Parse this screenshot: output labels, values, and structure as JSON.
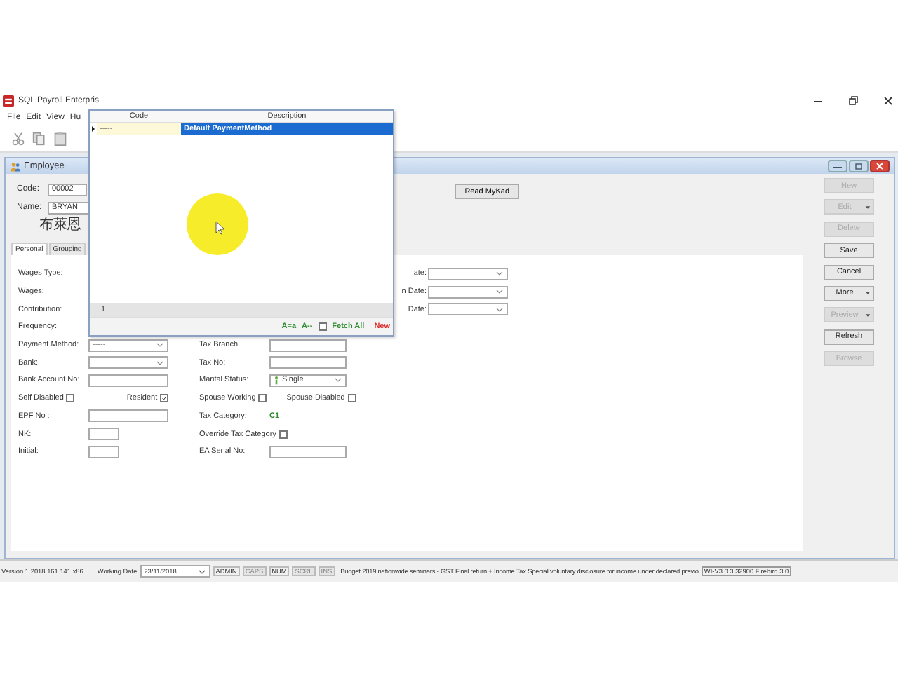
{
  "app": {
    "title": "SQL Payroll Enterpris",
    "menu": [
      "File",
      "Edit",
      "View",
      "Hu"
    ]
  },
  "employee_window": {
    "title": "Employee",
    "header": {
      "code_label": "Code:",
      "code": "00002",
      "name_label": "Name:",
      "name": "BRYAN",
      "other_name": "布萊恩",
      "read_mykad": "Read MyKad"
    },
    "tabs": [
      {
        "label": "Personal",
        "selected": true
      },
      {
        "label": "Grouping",
        "selected": false
      }
    ],
    "form": [
      {
        "left": {
          "label": "Wages Type:",
          "kind": "none"
        },
        "right": {
          "label": "ate:",
          "kind": "combo"
        }
      },
      {
        "left": {
          "label": "Wages:",
          "kind": "none"
        },
        "right": {
          "label": "n Date:",
          "kind": "combo"
        }
      },
      {
        "left": {
          "label": "Contribution:",
          "kind": "none"
        },
        "right": {
          "label": "Date:",
          "kind": "combo"
        }
      },
      {
        "left": {
          "label": "Frequency:",
          "kind": "none"
        }
      },
      {
        "left": {
          "label": "Payment Method:",
          "kind": "combo",
          "value": "-----"
        },
        "middle": {
          "label": "Tax Branch:",
          "kind": "text"
        }
      },
      {
        "left": {
          "label": "Bank:",
          "kind": "combo"
        },
        "middle": {
          "label": "Tax No:",
          "kind": "text"
        }
      },
      {
        "left": {
          "label": "Bank Account No:",
          "kind": "text"
        },
        "middle": {
          "label": "Marital Status:",
          "kind": "combo",
          "value": "Single",
          "icon": true
        }
      },
      {
        "left": {
          "kind": "checks",
          "items": [
            {
              "label": "Self Disabled",
              "checked": false
            },
            {
              "label": "Resident",
              "checked": true
            }
          ]
        },
        "middle": {
          "kind": "checks",
          "items": [
            {
              "label": "Spouse Working",
              "checked": false
            },
            {
              "label": "Spouse Disabled",
              "checked": false
            }
          ]
        }
      },
      {
        "left": {
          "label": "EPF No :",
          "kind": "text"
        },
        "middle": {
          "label": "Tax Category:",
          "kind": "static",
          "value": "C1"
        }
      },
      {
        "left": {
          "label": "NK:",
          "kind": "small"
        },
        "middle": {
          "kind": "checks",
          "items": [
            {
              "label": "Override Tax Category",
              "checked": false
            }
          ]
        }
      },
      {
        "left": {
          "label": "Initial:",
          "kind": "small"
        },
        "middle": {
          "label": "EA Serial No:",
          "kind": "text"
        }
      }
    ],
    "buttons": [
      {
        "label": "New",
        "disabled": true,
        "dropdown": false
      },
      {
        "label": "Edit",
        "disabled": true,
        "dropdown": true
      },
      {
        "label": "Delete",
        "disabled": true,
        "dropdown": false
      },
      {
        "label": "Save",
        "disabled": false,
        "dropdown": false
      },
      {
        "label": "Cancel",
        "disabled": false,
        "dropdown": false
      },
      {
        "label": "More",
        "disabled": false,
        "dropdown": true
      },
      {
        "label": "Preview",
        "disabled": true,
        "dropdown": true
      },
      {
        "label": "Refresh",
        "disabled": false,
        "dropdown": false
      },
      {
        "label": "Browse",
        "disabled": true,
        "dropdown": false
      }
    ]
  },
  "lookup_popup": {
    "columns": [
      "Code",
      "Description"
    ],
    "rows": [
      {
        "code": "-----",
        "description": "Default PaymentMethod",
        "selected": true
      }
    ],
    "record_count": "1",
    "case_sensitive": "A=a",
    "sort": "A--",
    "fetch_all": {
      "label": "Fetch All",
      "checked": false
    },
    "new": "New"
  },
  "status_bar": {
    "version": "Version 1.2018.161.141 x86",
    "working_date_label": "Working Date",
    "working_date": "23/11/2018",
    "indicators": [
      {
        "label": "ADMIN",
        "on": true
      },
      {
        "label": "CAPS",
        "on": false
      },
      {
        "label": "NUM",
        "on": true
      },
      {
        "label": "SCRL",
        "on": false
      },
      {
        "label": "INS",
        "on": false
      }
    ],
    "news": "Budget 2019 nationwide seminars - GST Final return + Income Tax Special voluntary disclosure for income under declared previo",
    "build": "WI-V3.0.3.32900 Firebird 3.0"
  }
}
